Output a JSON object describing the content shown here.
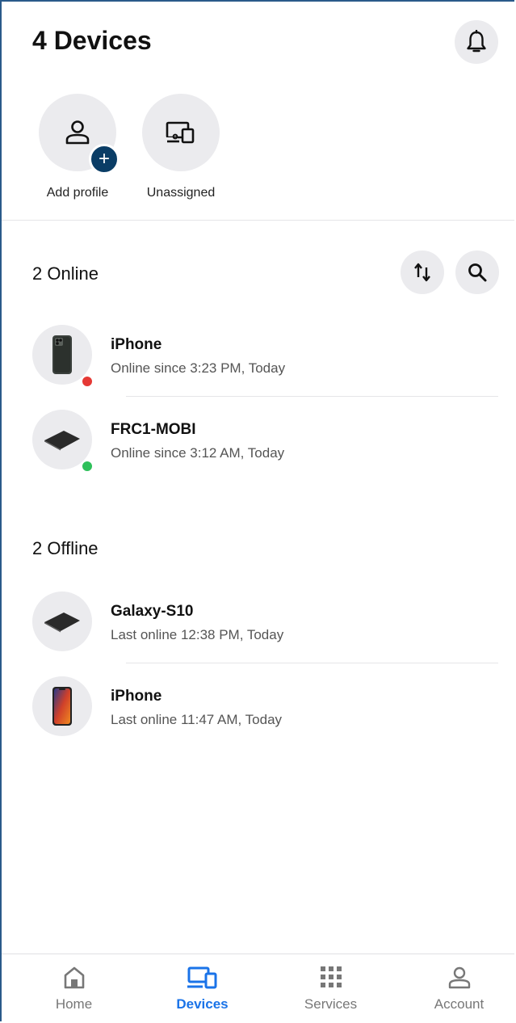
{
  "header": {
    "title": "4 Devices"
  },
  "profiles": [
    {
      "label": "Add profile"
    },
    {
      "label": "Unassigned"
    }
  ],
  "online": {
    "title": "2 Online",
    "devices": [
      {
        "name": "iPhone",
        "status": "Online since 3:23 PM, Today",
        "dot_color": "#e53935"
      },
      {
        "name": "FRC1-MOBI",
        "status": "Online since 3:12 AM, Today",
        "dot_color": "#2ec05a"
      }
    ]
  },
  "offline": {
    "title": "2 Offline",
    "devices": [
      {
        "name": "Galaxy-S10",
        "status": "Last online 12:38 PM, Today"
      },
      {
        "name": "iPhone",
        "status": "Last online 11:47 AM, Today"
      }
    ]
  },
  "nav": {
    "items": [
      {
        "label": "Home",
        "icon": "home-icon"
      },
      {
        "label": "Devices",
        "icon": "devices-icon"
      },
      {
        "label": "Services",
        "icon": "grid-icon"
      },
      {
        "label": "Account",
        "icon": "person-icon"
      }
    ],
    "active_color": "#1a73e8"
  }
}
